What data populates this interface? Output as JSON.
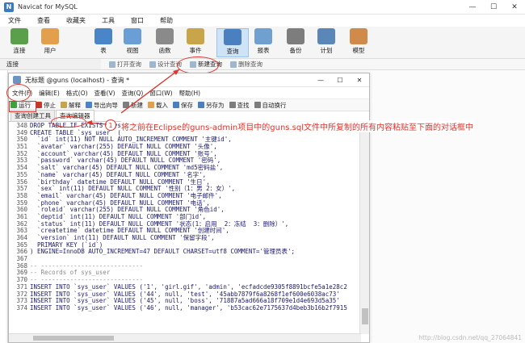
{
  "main_window": {
    "title": "Navicat for MySQL",
    "app_icon_letter": "N",
    "controls": [
      "—",
      "☐",
      "✕"
    ]
  },
  "menubar": [
    "文件",
    "查看",
    "收藏夹",
    "工具",
    "窗口",
    "帮助"
  ],
  "toolbar": [
    {
      "label": "连接",
      "icon": "connect-icon",
      "color": "#5aa04a"
    },
    {
      "label": "用户",
      "icon": "user-icon",
      "color": "#e2a04c"
    },
    {
      "label": "表",
      "icon": "table-icon",
      "color": "#4a86c7"
    },
    {
      "label": "视图",
      "icon": "view-icon",
      "color": "#6a9fd6"
    },
    {
      "label": "函数",
      "icon": "function-icon",
      "color": "#8a8a8a"
    },
    {
      "label": "事件",
      "icon": "event-icon",
      "color": "#c9a54a"
    },
    {
      "label": "查询",
      "icon": "query-icon",
      "color": "#4a7fc0"
    },
    {
      "label": "报表",
      "icon": "report-icon",
      "color": "#6fa0d0"
    },
    {
      "label": "备份",
      "icon": "backup-icon",
      "color": "#7d7d7d"
    },
    {
      "label": "计划",
      "icon": "schedule-icon",
      "color": "#5b86b8"
    },
    {
      "label": "模型",
      "icon": "model-icon",
      "color": "#d08a4a"
    }
  ],
  "nav_label": "连接",
  "sub_toolbar": [
    "打开查询",
    "设计查询",
    "新建查询",
    "删除查询"
  ],
  "query_window": {
    "title": "无标题 @guns (localhost) - 查询 *",
    "controls": [
      "—",
      "☐",
      "✕"
    ],
    "menu": [
      "文件(F)",
      "编辑(E)",
      "格式(O)",
      "查看(V)",
      "查询(Q)",
      "窗口(W)",
      "帮助(H)"
    ],
    "toolbar": [
      {
        "label": "运行",
        "color": "#3aa33a"
      },
      {
        "label": "停止",
        "color": "#c0392b"
      },
      {
        "label": "解释",
        "color": "#c9a54a"
      },
      {
        "label": "导出向导",
        "color": "#4a86c7"
      },
      {
        "label": "新建",
        "color": "#7d7d7d"
      },
      {
        "label": "载入",
        "color": "#e2a04c"
      },
      {
        "label": "保存",
        "color": "#4a7fc0"
      },
      {
        "label": "另存为",
        "color": "#4a7fc0"
      },
      {
        "label": "查找",
        "color": "#7d7d7d"
      },
      {
        "label": "自动换行",
        "color": "#7d7d7d"
      }
    ],
    "tabs": [
      "查询创建工具",
      "查询编辑器"
    ],
    "code_lines": [
      {
        "n": "348",
        "t": "DROP TABLE IF EXISTS `sys_user`;"
      },
      {
        "n": "349",
        "t": "CREATE TABLE `sys_user` ("
      },
      {
        "n": "350",
        "t": "  `id` int(11) NOT NULL AUTO_INCREMENT COMMENT '主键id',"
      },
      {
        "n": "351",
        "t": "  `avatar` varchar(255) DEFAULT NULL COMMENT '头像',"
      },
      {
        "n": "352",
        "t": "  `account` varchar(45) DEFAULT NULL COMMENT '账号',"
      },
      {
        "n": "353",
        "t": "  `password` varchar(45) DEFAULT NULL COMMENT '密码',"
      },
      {
        "n": "354",
        "t": "  `salt` varchar(45) DEFAULT NULL COMMENT 'md5密码盐',"
      },
      {
        "n": "355",
        "t": "  `name` varchar(45) DEFAULT NULL COMMENT '名字',"
      },
      {
        "n": "356",
        "t": "  `birthday` datetime DEFAULT NULL COMMENT '生日',"
      },
      {
        "n": "357",
        "t": "  `sex` int(11) DEFAULT NULL COMMENT '性别（1：男 2：女）',"
      },
      {
        "n": "358",
        "t": "  `email` varchar(45) DEFAULT NULL COMMENT '电子邮件',"
      },
      {
        "n": "359",
        "t": "  `phone` varchar(45) DEFAULT NULL COMMENT '电话',"
      },
      {
        "n": "360",
        "t": "  `roleid` varchar(255) DEFAULT NULL COMMENT '角色id',"
      },
      {
        "n": "361",
        "t": "  `deptid` int(11) DEFAULT NULL COMMENT '部门id',"
      },
      {
        "n": "362",
        "t": "  `status` int(11) DEFAULT NULL COMMENT '状态(1：启用  2：冻结  3：删除）',"
      },
      {
        "n": "363",
        "t": "  `createtime` datetime DEFAULT NULL COMMENT '创建时间',"
      },
      {
        "n": "364",
        "t": "  `version` int(11) DEFAULT NULL COMMENT '保留字段',"
      },
      {
        "n": "365",
        "t": "  PRIMARY KEY (`id`)"
      },
      {
        "n": "366",
        "t": ") ENGINE=InnoDB AUTO_INCREMENT=47 DEFAULT CHARSET=utf8 COMMENT='管理员表';"
      },
      {
        "n": "367",
        "t": ""
      },
      {
        "n": "368",
        "t": "-- ----------------------------",
        "c": true
      },
      {
        "n": "369",
        "t": "-- Records of sys_user",
        "c": true
      },
      {
        "n": "370",
        "t": "-- ----------------------------",
        "c": true
      },
      {
        "n": "371",
        "t": "INSERT INTO `sys_user` VALUES ('1', 'girl.gif', 'admin', 'ecfadcde9305f8891bcfe5a1e28c2"
      },
      {
        "n": "372",
        "t": "INSERT INTO `sys_user` VALUES ('44', null, 'test', '45abb7879f6a8268f1ef600e6038ac73'"
      },
      {
        "n": "373",
        "t": "INSERT INTO `sys_user` VALUES ('45', null, 'boss', '71887a5ad666a18f709e1d4e693d5a35'"
      },
      {
        "n": "374",
        "t": "INSERT INTO `sys_user` VALUES ('46', null, 'manager', 'b53cac62e7175637d4beb3b16b2f7915"
      }
    ]
  },
  "annotation": {
    "number": "1",
    "text": "将之前在Eclipse的guns-admin项目中的guns.sql文件中所复制的所有内容粘贴至下面的对话框中"
  },
  "watermark": "http://blog.csdn.net/qq_27064841",
  "colors": {
    "annotation_red": "#e0342c",
    "active_toolbar": "#cfe3f7"
  }
}
